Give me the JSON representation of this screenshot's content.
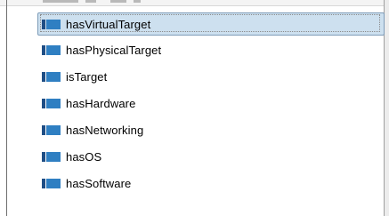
{
  "property_list": {
    "items": [
      {
        "label": "hasVirtualTarget",
        "icon": "object-property-icon",
        "selected": true
      },
      {
        "label": "hasPhysicalTarget",
        "icon": "object-property-icon",
        "selected": false
      },
      {
        "label": "isTarget",
        "icon": "object-property-icon",
        "selected": false
      },
      {
        "label": "hasHardware",
        "icon": "object-property-icon",
        "selected": false
      },
      {
        "label": "hasNetworking",
        "icon": "object-property-icon",
        "selected": false
      },
      {
        "label": "hasOS",
        "icon": "object-property-icon",
        "selected": false
      },
      {
        "label": "hasSoftware",
        "icon": "object-property-icon",
        "selected": false
      }
    ]
  },
  "colors": {
    "selection_background": "#cde0ef",
    "selection_border": "#7f9db9",
    "icon_dark": "#1f4e85",
    "icon_light": "#2f7fc2"
  }
}
